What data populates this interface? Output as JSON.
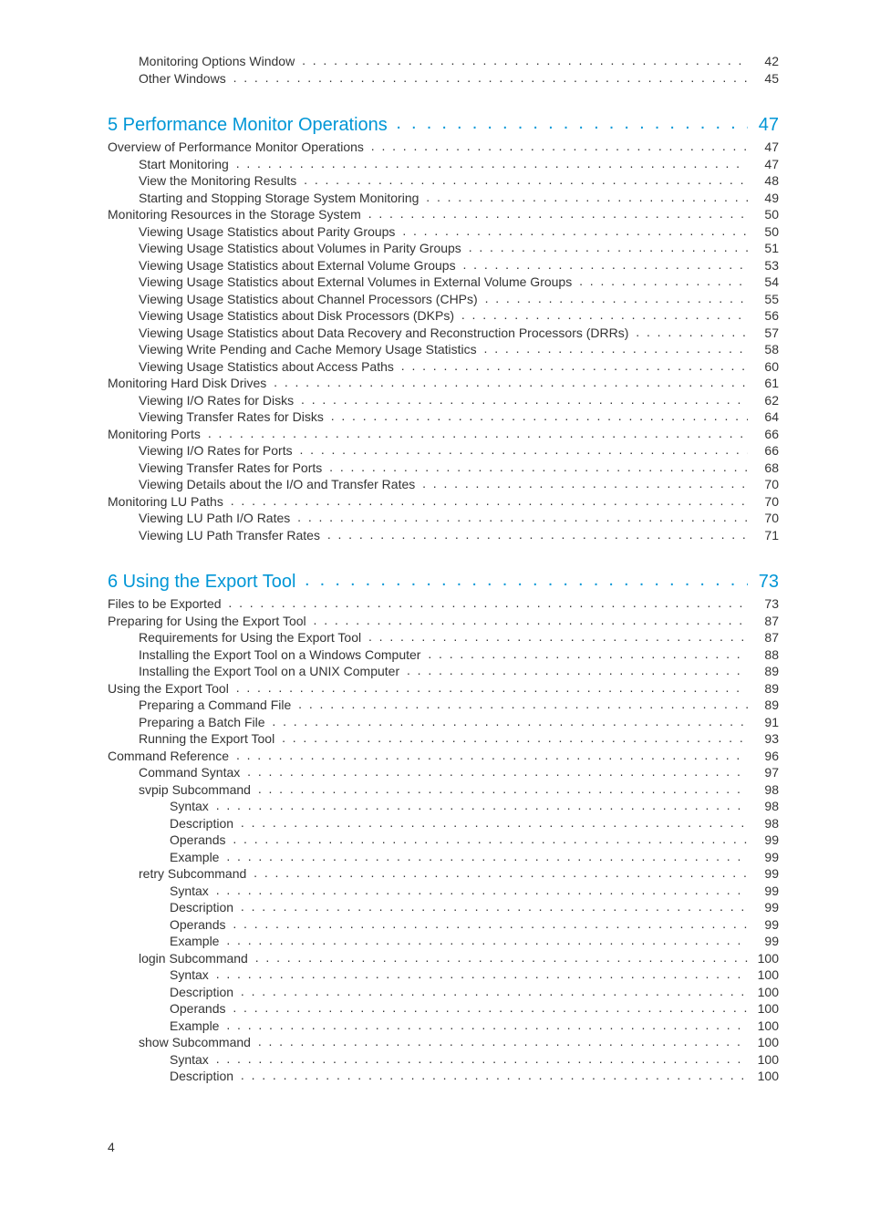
{
  "footer_page_number": "4",
  "entries": [
    {
      "indent": 1,
      "label": "Monitoring Options Window",
      "page": "42",
      "chapter": false
    },
    {
      "indent": 1,
      "label": "Other Windows",
      "page": "45",
      "chapter": false
    },
    {
      "indent": 0,
      "label": "5 Performance Monitor Operations",
      "page": "47",
      "chapter": true
    },
    {
      "indent": 0,
      "label": "Overview of Performance Monitor Operations",
      "page": "47",
      "chapter": false
    },
    {
      "indent": 1,
      "label": "Start Monitoring",
      "page": "47",
      "chapter": false
    },
    {
      "indent": 1,
      "label": "View the Monitoring Results",
      "page": "48",
      "chapter": false
    },
    {
      "indent": 1,
      "label": "Starting and Stopping Storage System Monitoring",
      "page": "49",
      "chapter": false
    },
    {
      "indent": 0,
      "label": "Monitoring Resources in the Storage System",
      "page": "50",
      "chapter": false
    },
    {
      "indent": 1,
      "label": "Viewing Usage Statistics about Parity Groups",
      "page": "50",
      "chapter": false
    },
    {
      "indent": 1,
      "label": "Viewing Usage Statistics about Volumes in Parity Groups",
      "page": "51",
      "chapter": false
    },
    {
      "indent": 1,
      "label": "Viewing Usage Statistics about External Volume Groups",
      "page": "53",
      "chapter": false
    },
    {
      "indent": 1,
      "label": "Viewing Usage Statistics about External Volumes in External Volume Groups",
      "page": "54",
      "chapter": false
    },
    {
      "indent": 1,
      "label": "Viewing Usage Statistics about Channel Processors (CHPs)",
      "page": "55",
      "chapter": false
    },
    {
      "indent": 1,
      "label": "Viewing Usage Statistics about Disk Processors (DKPs)",
      "page": "56",
      "chapter": false
    },
    {
      "indent": 1,
      "label": "Viewing Usage Statistics about Data Recovery and Reconstruction Processors (DRRs)",
      "page": "57",
      "chapter": false
    },
    {
      "indent": 1,
      "label": "Viewing Write Pending and Cache Memory Usage Statistics",
      "page": "58",
      "chapter": false
    },
    {
      "indent": 1,
      "label": "Viewing Usage Statistics about Access Paths",
      "page": "60",
      "chapter": false
    },
    {
      "indent": 0,
      "label": "Monitoring Hard Disk Drives",
      "page": "61",
      "chapter": false
    },
    {
      "indent": 1,
      "label": "Viewing I/O Rates for Disks",
      "page": "62",
      "chapter": false
    },
    {
      "indent": 1,
      "label": "Viewing Transfer Rates for Disks",
      "page": "64",
      "chapter": false
    },
    {
      "indent": 0,
      "label": "Monitoring Ports",
      "page": "66",
      "chapter": false
    },
    {
      "indent": 1,
      "label": "Viewing I/O Rates for Ports",
      "page": "66",
      "chapter": false
    },
    {
      "indent": 1,
      "label": "Viewing Transfer Rates for Ports",
      "page": "68",
      "chapter": false
    },
    {
      "indent": 1,
      "label": "Viewing Details about the I/O and Transfer Rates",
      "page": "70",
      "chapter": false
    },
    {
      "indent": 0,
      "label": "Monitoring LU Paths",
      "page": "70",
      "chapter": false
    },
    {
      "indent": 1,
      "label": "Viewing LU Path I/O Rates",
      "page": "70",
      "chapter": false
    },
    {
      "indent": 1,
      "label": "Viewing LU Path Transfer Rates",
      "page": "71",
      "chapter": false
    },
    {
      "indent": 0,
      "label": "6 Using the Export Tool",
      "page": "73",
      "chapter": true
    },
    {
      "indent": 0,
      "label": "Files to be Exported",
      "page": "73",
      "chapter": false
    },
    {
      "indent": 0,
      "label": "Preparing for Using the Export Tool",
      "page": "87",
      "chapter": false
    },
    {
      "indent": 1,
      "label": "Requirements for Using the Export Tool",
      "page": "87",
      "chapter": false
    },
    {
      "indent": 1,
      "label": "Installing the Export Tool on a Windows Computer",
      "page": "88",
      "chapter": false
    },
    {
      "indent": 1,
      "label": "Installing the Export Tool on a UNIX Computer",
      "page": "89",
      "chapter": false
    },
    {
      "indent": 0,
      "label": "Using the Export Tool",
      "page": "89",
      "chapter": false
    },
    {
      "indent": 1,
      "label": "Preparing a Command File",
      "page": "89",
      "chapter": false
    },
    {
      "indent": 1,
      "label": "Preparing a Batch File",
      "page": "91",
      "chapter": false
    },
    {
      "indent": 1,
      "label": "Running the Export Tool",
      "page": "93",
      "chapter": false
    },
    {
      "indent": 0,
      "label": "Command Reference",
      "page": "96",
      "chapter": false
    },
    {
      "indent": 1,
      "label": "Command Syntax",
      "page": "97",
      "chapter": false
    },
    {
      "indent": 1,
      "label": "svpip Subcommand",
      "page": "98",
      "chapter": false
    },
    {
      "indent": 2,
      "label": "Syntax",
      "page": "98",
      "chapter": false
    },
    {
      "indent": 2,
      "label": "Description",
      "page": "98",
      "chapter": false
    },
    {
      "indent": 2,
      "label": "Operands",
      "page": "99",
      "chapter": false
    },
    {
      "indent": 2,
      "label": "Example",
      "page": "99",
      "chapter": false
    },
    {
      "indent": 1,
      "label": "retry Subcommand",
      "page": "99",
      "chapter": false
    },
    {
      "indent": 2,
      "label": "Syntax",
      "page": "99",
      "chapter": false
    },
    {
      "indent": 2,
      "label": "Description",
      "page": "99",
      "chapter": false
    },
    {
      "indent": 2,
      "label": "Operands",
      "page": "99",
      "chapter": false
    },
    {
      "indent": 2,
      "label": "Example",
      "page": "99",
      "chapter": false
    },
    {
      "indent": 1,
      "label": "login Subcommand",
      "page": "100",
      "chapter": false
    },
    {
      "indent": 2,
      "label": "Syntax",
      "page": "100",
      "chapter": false
    },
    {
      "indent": 2,
      "label": "Description",
      "page": "100",
      "chapter": false
    },
    {
      "indent": 2,
      "label": "Operands",
      "page": "100",
      "chapter": false
    },
    {
      "indent": 2,
      "label": "Example",
      "page": "100",
      "chapter": false
    },
    {
      "indent": 1,
      "label": "show Subcommand",
      "page": "100",
      "chapter": false
    },
    {
      "indent": 2,
      "label": "Syntax",
      "page": "100",
      "chapter": false
    },
    {
      "indent": 2,
      "label": "Description",
      "page": "100",
      "chapter": false
    }
  ]
}
